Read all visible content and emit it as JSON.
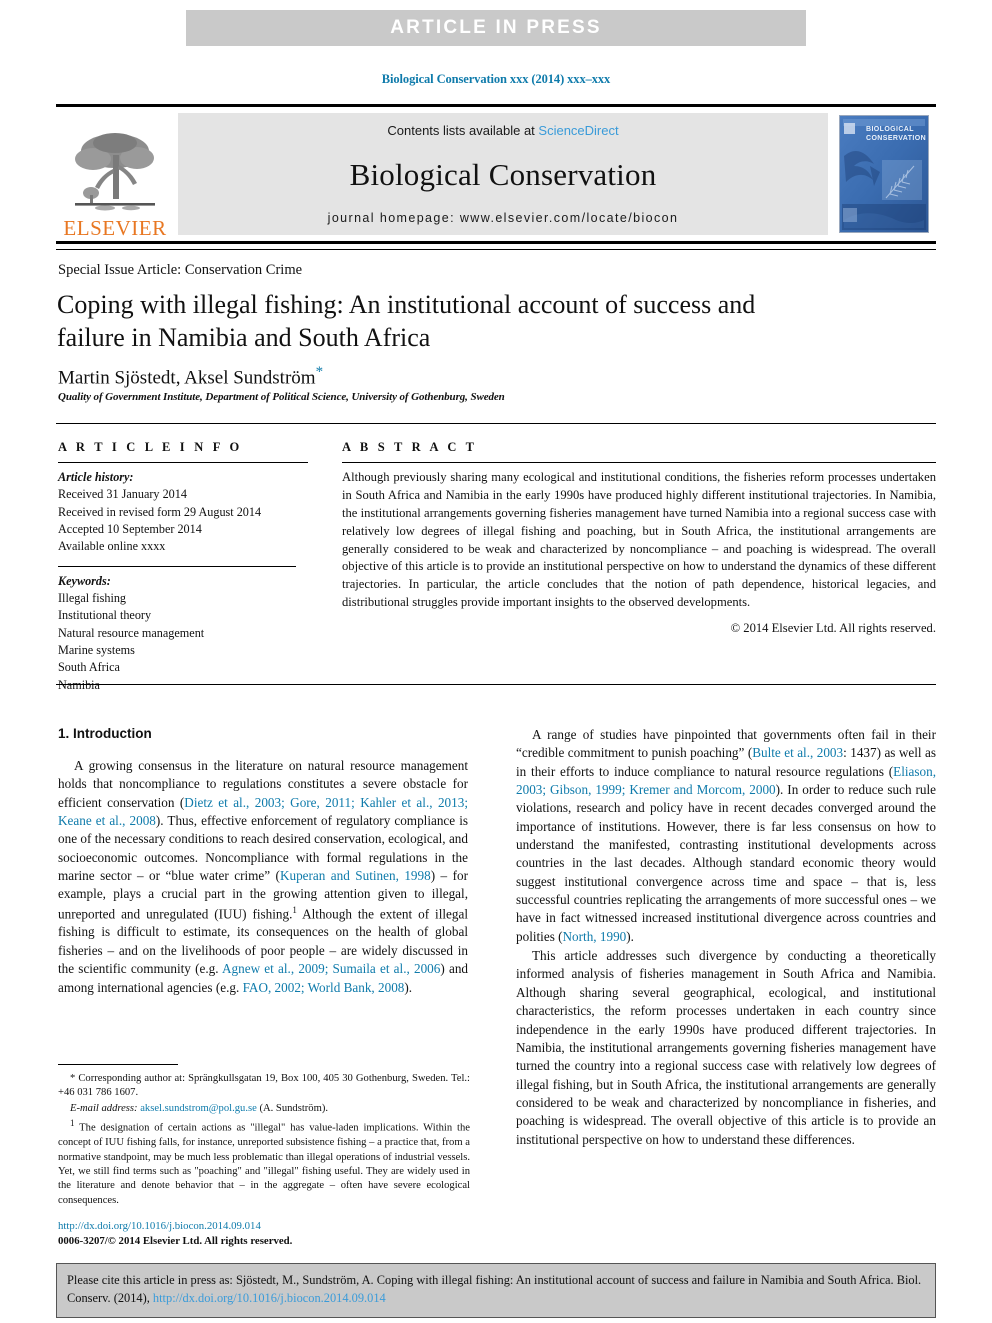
{
  "banner": {
    "text": "ARTICLE IN PRESS",
    "bg": "#c9c9c9",
    "fg": "#ffffff"
  },
  "journal_ref": "Biological Conservation xxx (2014) xxx–xxx",
  "masthead": {
    "publisher_logo_text": "ELSEVIER",
    "contents_prefix": "Contents lists available at ",
    "contents_link": "ScienceDirect",
    "journal_name": "Biological Conservation",
    "homepage_line": "journal homepage: www.elsevier.com/locate/biocon",
    "cover_title": "BIOLOGICAL\nCONSERVATION",
    "cover_color": "#3d6fb4",
    "accent_orange": "#e87722",
    "link_blue": "#3a9bd9"
  },
  "article": {
    "special_issue": "Special Issue Article: Conservation Crime",
    "title": "Coping with illegal fishing: An institutional account of success and failure in Namibia and South Africa",
    "authors": "Martin Sjöstedt, Aksel Sundström",
    "corresponding_marker": "*",
    "affiliation": "Quality of Government Institute, Department of Political Science, University of Gothenburg, Sweden"
  },
  "info": {
    "heading": "A R T I C L E   I N F O",
    "history_label": "Article history:",
    "history": [
      "Received 31 January 2014",
      "Received in revised form 29 August 2014",
      "Accepted 10 September 2014",
      "Available online xxxx"
    ],
    "keywords_label": "Keywords:",
    "keywords": [
      "Illegal fishing",
      "Institutional theory",
      "Natural resource management",
      "Marine systems",
      "South Africa",
      "Namibia"
    ]
  },
  "abstract": {
    "heading": "A B S T R A C T",
    "text": "Although previously sharing many ecological and institutional conditions, the fisheries reform processes undertaken in South Africa and Namibia in the early 1990s have produced highly different institutional trajectories. In Namibia, the institutional arrangements governing fisheries management have turned Namibia into a regional success case with relatively low degrees of illegal fishing and poaching, but in South Africa, the institutional arrangements are generally considered to be weak and characterized by noncompliance – and poaching is widespread. The overall objective of this article is to provide an institutional perspective on how to understand the dynamics of these different trajectories. In particular, the article concludes that the notion of path dependence, historical legacies, and distributional struggles provide important insights to the observed developments.",
    "copyright": "© 2014 Elsevier Ltd. All rights reserved."
  },
  "body": {
    "section_heading": "1. Introduction",
    "left_paragraph_1_a": "A growing consensus in the literature on natural resource management holds that noncompliance to regulations constitutes a severe obstacle for efficient conservation (",
    "left_ref_1": "Dietz et al., 2003; Gore, 2011; Kahler et al., 2013; Keane et al., 2008",
    "left_paragraph_1_b": "). Thus, effective enforcement of regulatory compliance is one of the necessary conditions to reach desired conservation, ecological, and socioeconomic outcomes. Noncompliance with formal regulations in the marine sector – or “blue water crime” (",
    "left_ref_2": "Kuperan and Sutinen, 1998",
    "left_paragraph_1_c": ") – for example, plays a crucial part in the growing attention given to illegal, unreported and unregulated (IUU) fishing.",
    "left_footnote_marker": "1",
    "left_paragraph_1_d": " Although the extent of illegal fishing is difficult to estimate, its consequences on the health of global fisheries – and on the livelihoods of poor people – are widely discussed in the scientific community (e.g. ",
    "left_ref_3": "Agnew et al., 2009; Sumaila et al., 2006",
    "left_paragraph_1_e": ") and among international agencies (e.g. ",
    "left_ref_4": "FAO, 2002; World Bank, 2008",
    "left_paragraph_1_f": ").",
    "right_p1_a": "A range of studies have pinpointed that governments often fail in their “credible commitment to punish poaching” (",
    "right_ref_1": "Bulte et al., 2003",
    "right_p1_b": ": 1437) as well as in their efforts to induce compliance to natural resource regulations (",
    "right_ref_2": "Eliason, 2003; Gibson, 1999; Kremer and Morcom, 2000",
    "right_p1_c": "). In order to reduce such rule violations, research and policy have in recent decades converged around the importance of institutions. However, there is far less consensus on how to understand the manifested, contrasting institutional developments across countries in the last decades. Although standard economic theory would suggest institutional convergence across time and space – that is, less successful countries replicating the arrangements of more successful ones – we have in fact witnessed increased institutional divergence across countries and polities (",
    "right_ref_3": "North, 1990",
    "right_p1_d": ").",
    "right_p2": "This article addresses such divergence by conducting a theoretically informed analysis of fisheries management in South Africa and Namibia. Although sharing several geographical, ecological, and institutional characteristics, the reform processes undertaken in each country since independence in the early 1990s have produced different trajectories. In Namibia, the institutional arrangements governing fisheries management have turned the country into a regional success case with relatively low degrees of illegal fishing, but in South Africa, the institutional arrangements are generally considered to be weak and characterized by noncompliance in fisheries, and poaching is widespread. The overall objective of this article is to provide an institutional perspective on how to understand these differences."
  },
  "footnotes": {
    "corresponding_marker": "*",
    "corresponding_text": " Corresponding author at: Sprängkullsgatan 19, Box 100, 405 30 Gothenburg, Sweden. Tel.: +46 031 786 1607.",
    "email_label": "E-mail address:",
    "email": "aksel.sundstrom@pol.gu.se",
    "email_suffix": " (A. Sundström).",
    "note_marker": "1",
    "note_text": " The designation of certain actions as \"illegal\" has value-laden implications. Within the concept of IUU fishing falls, for instance, unreported subsistence fishing – a practice that, from a normative standpoint, may be much less problematic than illegal operations of industrial vessels. Yet, we still find terms such as \"poaching\" and \"illegal\" fishing useful. They are widely used in the literature and denote behavior that – in the aggregate – often have severe ecological consequences."
  },
  "doi": {
    "url": "http://dx.doi.org/10.1016/j.biocon.2014.09.014",
    "issn_line": "0006-3207/© 2014 Elsevier Ltd. All rights reserved."
  },
  "cite_box": {
    "text_a": "Please cite this article in press as: Sjöstedt, M., Sundström, A. Coping with illegal fishing: An institutional account of success and failure in Namibia and South Africa. Biol. Conserv. (2014), ",
    "link": "http://dx.doi.org/10.1016/j.biocon.2014.09.014"
  }
}
